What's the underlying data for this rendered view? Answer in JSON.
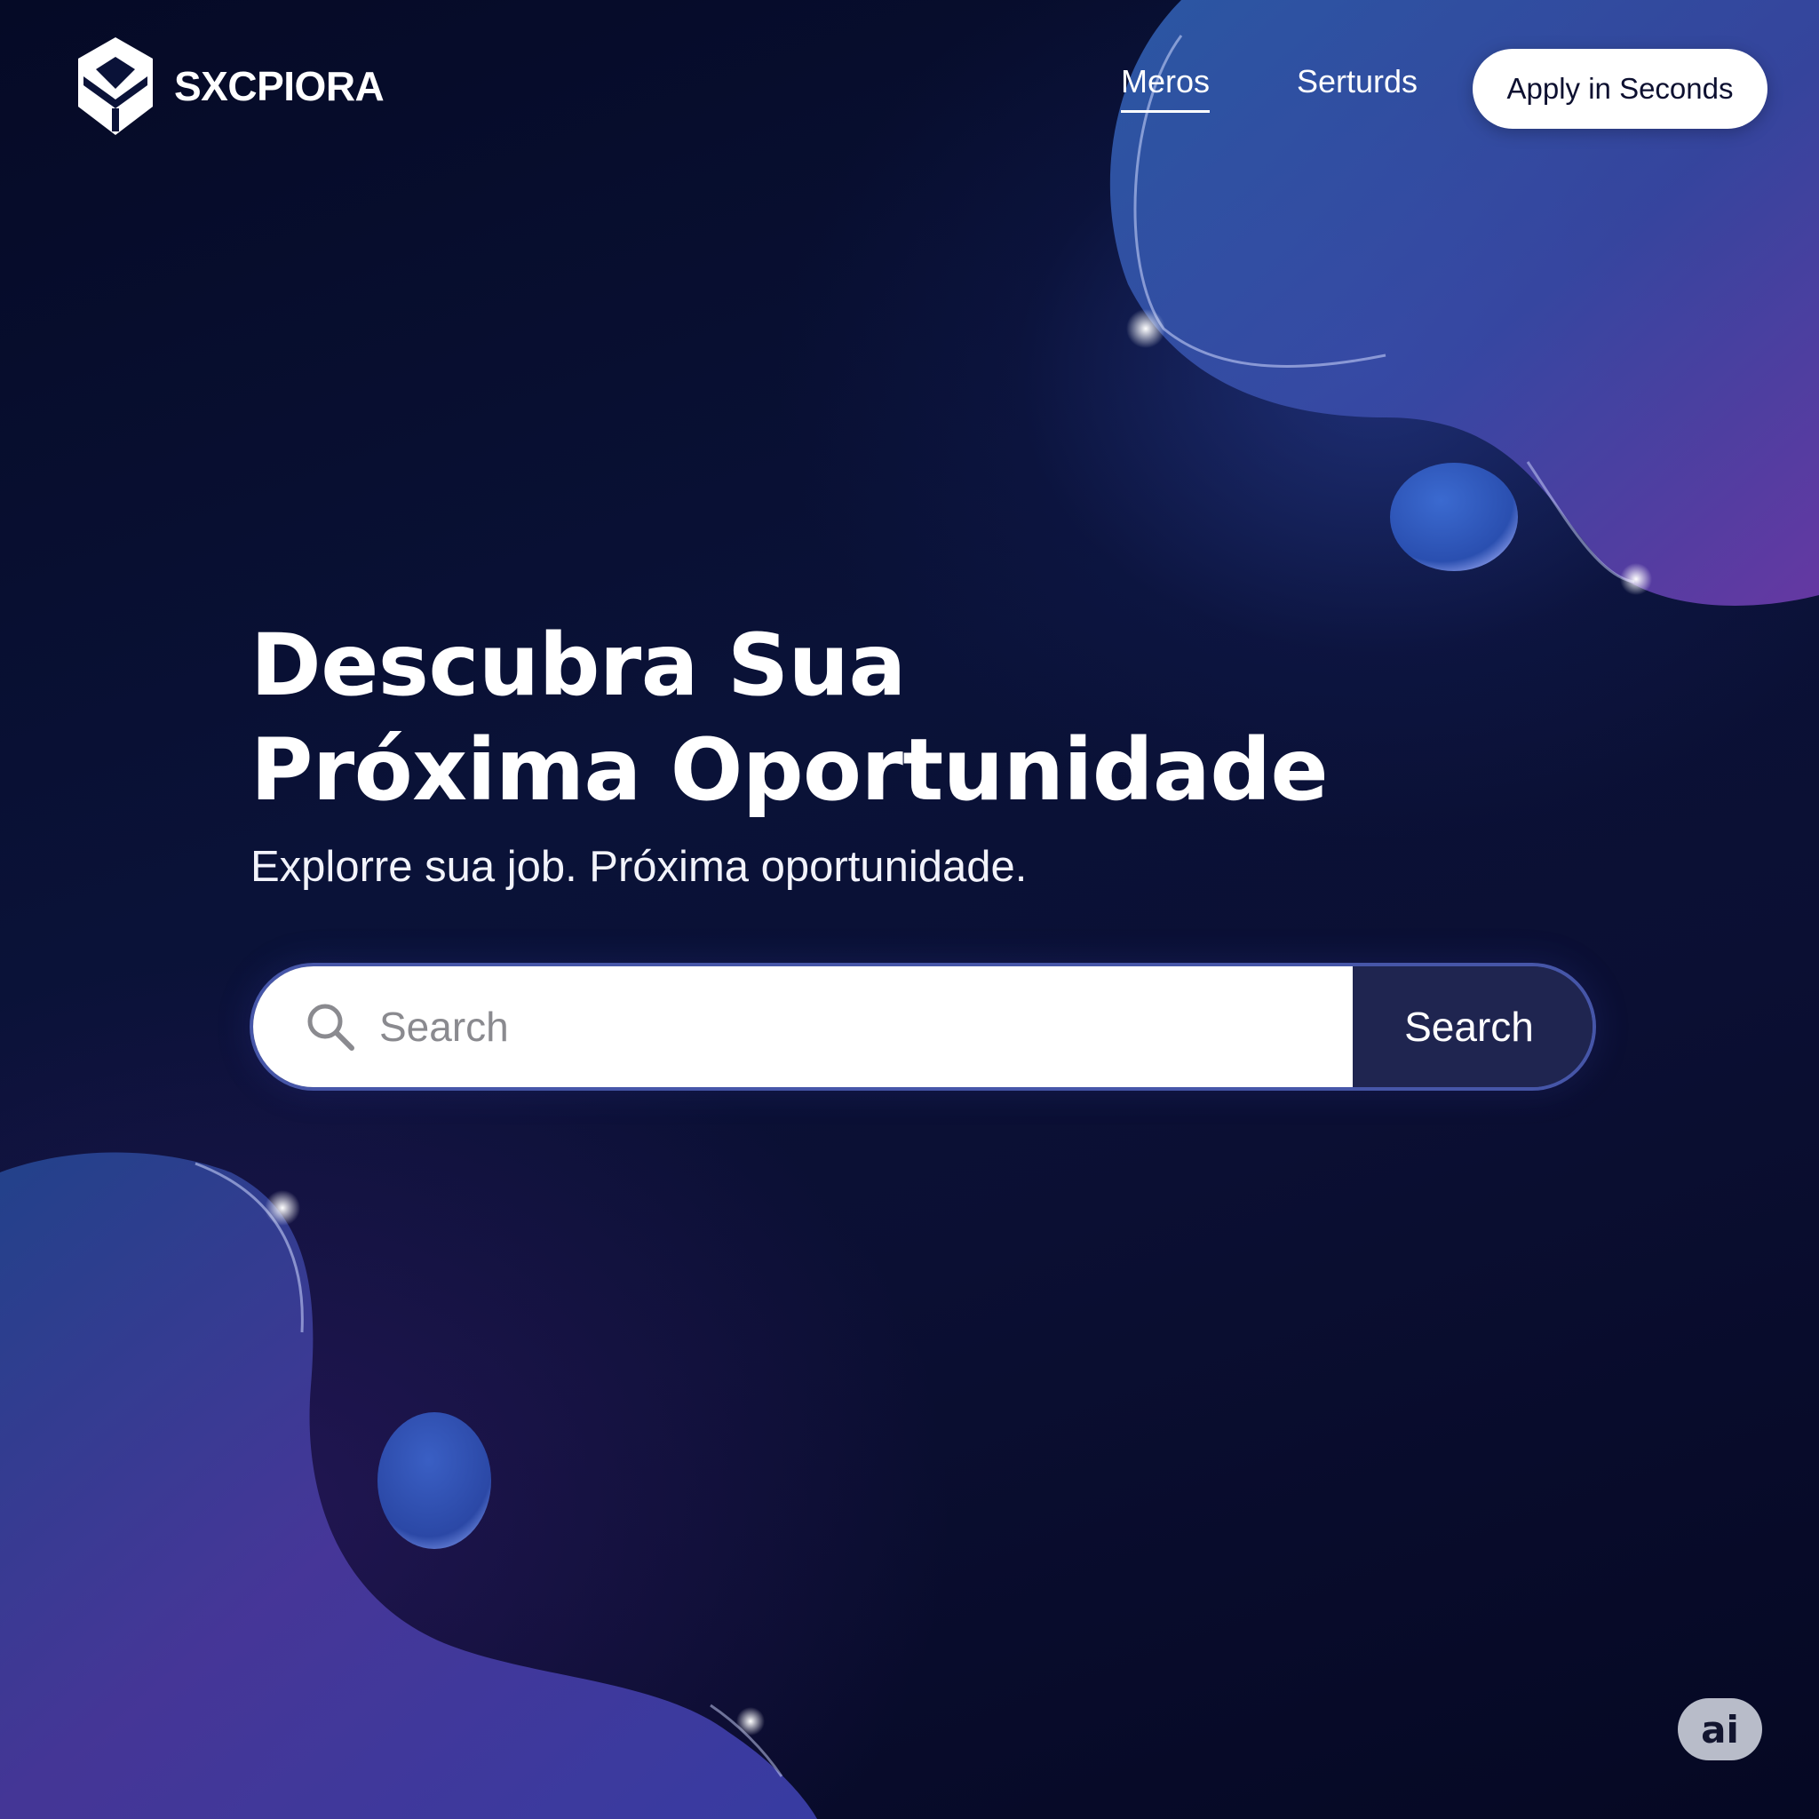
{
  "brand": {
    "name": "SXCPIORA",
    "logo_icon": "hexagon-leaf-logo"
  },
  "nav": {
    "links": [
      {
        "label": "Meros",
        "active": true
      },
      {
        "label": "Serturds",
        "active": false
      }
    ],
    "cta_label": "Apply in Seconds"
  },
  "hero": {
    "title_line1": "Descubra Sua",
    "title_line2": "Próxima Oportunidade",
    "subtitle": "Explorre sua job. Próxima oportunidade."
  },
  "search": {
    "placeholder": "Search",
    "button_label": "Search",
    "icon": "search-icon"
  },
  "badge": {
    "label": "ai"
  },
  "colors": {
    "background_dark": "#050a26",
    "accent_blue": "#3d5cc4",
    "accent_purple": "#6a3aa8",
    "search_button_bg": "#1f2550",
    "search_border": "#4656a8"
  }
}
